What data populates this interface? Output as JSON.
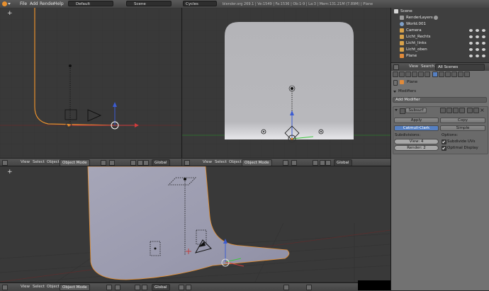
{
  "topbar": {
    "menus": [
      "File",
      "Add",
      "Render",
      "Help"
    ],
    "layout": "Default",
    "scene": "Scene",
    "engine": "Cycles",
    "stats": "blender.org 269.1 | Ve:1549 | Fa:1536 | Ob:1-9 | La:3 | Mem:131.21M (7.89M) | Plane"
  },
  "viewport_header": {
    "view": "View",
    "select": "Select",
    "object": "Object",
    "mode": "Object Mode",
    "orientation": "Global"
  },
  "outliner": {
    "items": [
      {
        "label": "Scene",
        "icon_color": "#d7d7d7"
      },
      {
        "label": "RenderLayers",
        "icon_color": "#9a9a9a"
      },
      {
        "label": "World.001",
        "icon_color": "#7fa0c8"
      },
      {
        "label": "Camera",
        "icon_color": "#d8a24a"
      },
      {
        "label": "Licht_Rechts",
        "icon_color": "#d8a24a"
      },
      {
        "label": "Licht_links",
        "icon_color": "#d8a24a"
      },
      {
        "label": "Licht_oben",
        "icon_color": "#d8a24a"
      },
      {
        "label": "Plane",
        "icon_color": "#e08a3a"
      }
    ]
  },
  "properties": {
    "header": {
      "view": "View",
      "search": "Search",
      "filter": "All Scenes"
    },
    "object_name": "Plane",
    "modifiers_title": "Modifiers",
    "add_modifier": "Add Modifier",
    "modifier_name": "Subsurf",
    "apply": "Apply",
    "copy": "Copy",
    "tabs": [
      "Catmull-Clark",
      "Simple"
    ],
    "subdivisions_label": "Subdivisions:",
    "options_label": "Options:",
    "view_field": "View: 4",
    "render_field": "Render: 2",
    "subdivide_uvs": "Subdivide UVs",
    "optimal_display": "Optimal Display"
  },
  "colors": {
    "accent": "#5680c2",
    "selection": "#e8902e",
    "axis_x": "#d23c3c",
    "axis_y": "#3cc83c",
    "axis_z": "#3c5cd2"
  }
}
